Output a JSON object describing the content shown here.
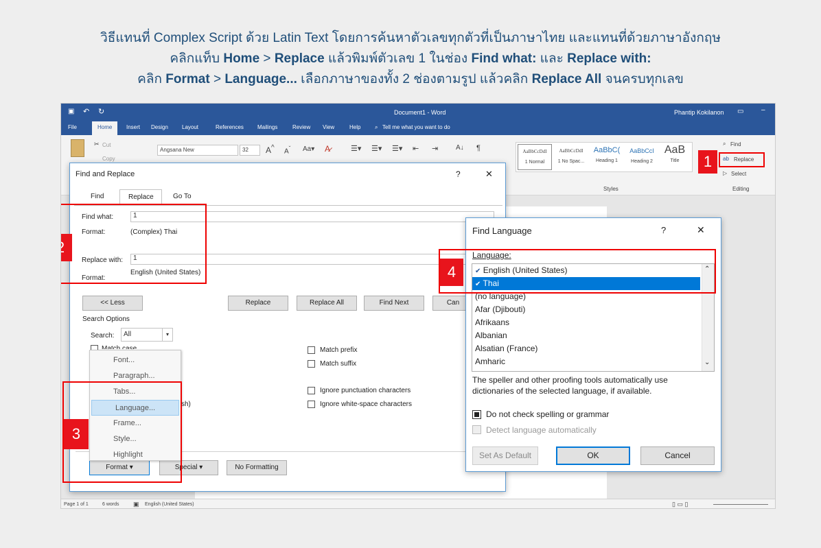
{
  "caption": {
    "line1": "วิธีแทนที่ Complex Script ด้วย Latin Text โดยการค้นหาตัวเลขทุกตัวที่เป็นภาษาไทย และแทนที่ด้วยภาษาอังกฤษ",
    "line2_a": "คลิกแท็บ ",
    "line2_home": "Home",
    "line2_b": " > ",
    "line2_replace": "Replace",
    "line2_c": " แล้วพิมพ์ตัวเลข 1 ในช่อง ",
    "line2_find": "Find what:",
    "line2_d": " และ ",
    "line2_repwith": "Replace with:",
    "line3_a": "คลิก ",
    "line3_format": "Format",
    "line3_b": " > ",
    "line3_language": "Language...",
    "line3_c": " เลือกภาษาของทั้ง 2 ช่องตามรูป แล้วคลิก ",
    "line3_replall": "Replace All",
    "line3_d": " จนครบทุกเลข"
  },
  "word": {
    "title": "Document1 - Word",
    "user": "Phantip Kokilanon",
    "tabs": [
      "File",
      "Home",
      "Insert",
      "Design",
      "Layout",
      "References",
      "Mailings",
      "Review",
      "View",
      "Help"
    ],
    "tell_me": "Tell me what you want to do",
    "cut": "Cut",
    "copy": "Copy",
    "font_name": "Angsana New",
    "font_size": "32",
    "styles": [
      {
        "sample": "AaBbCcDdI",
        "name": "1 Normal"
      },
      {
        "sample": "AaBbCcDdI",
        "name": "1 No Spac..."
      },
      {
        "sample": "AaBbC(",
        "name": "Heading 1"
      },
      {
        "sample": "AaBbCcI",
        "name": "Heading 2"
      },
      {
        "sample": "AaB",
        "name": "Title"
      }
    ],
    "styles_group": "Styles",
    "find": "Find",
    "replace": "Replace",
    "select": "Select",
    "editing_group": "Editing",
    "status_page": "Page 1 of 1",
    "status_words": "6 words",
    "status_lang": "English (United States)"
  },
  "find_replace": {
    "title": "Find and Replace",
    "help": "?",
    "close": "✕",
    "tabs": [
      "Find",
      "Replace",
      "Go To"
    ],
    "find_what_label": "Find what:",
    "find_what_value": "1",
    "format_label": "Format:",
    "find_format": "(Complex) Thai",
    "replace_with_label": "Replace with:",
    "replace_with_value": "1",
    "replace_format": "English (United States)",
    "less_btn": "<< Less",
    "replace_btn": "Replace",
    "replace_all_btn": "Replace All",
    "find_next_btn": "Find Next",
    "cancel_btn": "Can",
    "search_options": "Search Options",
    "search_label": "Search:",
    "search_value": "All",
    "match_case": "Match case",
    "match_prefix": "Match prefix",
    "match_suffix": "Match suffix",
    "ignore_punct": "Ignore punctuation characters",
    "ignore_ws": "Ignore white-space characters",
    "sh_fragment": "sh)",
    "format_btn": "Format ▾",
    "special_btn": "Special ▾",
    "no_formatting_btn": "No Formatting",
    "format_menu": [
      "Font...",
      "Paragraph...",
      "Tabs...",
      "Language...",
      "Frame...",
      "Style...",
      "Highlight"
    ]
  },
  "find_language": {
    "title": "Find Language",
    "help": "?",
    "close": "✕",
    "language_label": "Language:",
    "items": [
      "English (United States)",
      "Thai",
      "(no language)",
      "Afar (Djibouti)",
      "Afrikaans",
      "Albanian",
      "Alsatian (France)",
      "Amharic"
    ],
    "selected": "Thai",
    "description": "The speller and other proofing tools automatically use dictionaries of the selected language, if available.",
    "no_check": "Do not check spelling or grammar",
    "detect": "Detect language automatically",
    "set_default_btn": "Set As Default",
    "ok_btn": "OK",
    "cancel_btn": "Cancel"
  },
  "steps": [
    "1",
    "2",
    "3",
    "4"
  ],
  "colors": {
    "word_blue": "#2b579a",
    "caption": "#1f4e79",
    "badge": "#e8141c",
    "selection": "#0078d7"
  }
}
